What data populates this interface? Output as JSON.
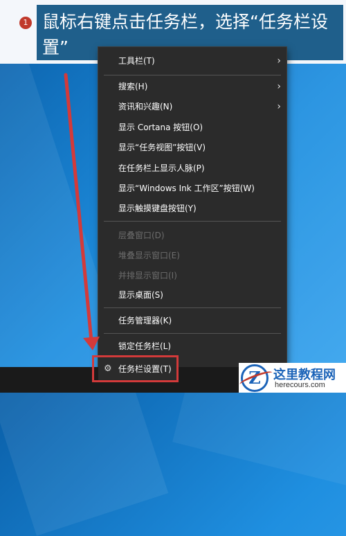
{
  "caption": {
    "step_number": "1",
    "text": "鼠标右键点击任务栏，选择“任务栏设置”"
  },
  "context_menu": {
    "items": [
      {
        "label": "工具栏(T)",
        "submenu": true,
        "enabled": true
      },
      {
        "label": "搜索(H)",
        "submenu": true,
        "enabled": true
      },
      {
        "label": "资讯和兴趣(N)",
        "submenu": true,
        "enabled": true
      },
      {
        "label": "显示 Cortana 按钮(O)",
        "submenu": false,
        "enabled": true
      },
      {
        "label": "显示“任务视图”按钮(V)",
        "submenu": false,
        "enabled": true
      },
      {
        "label": "在任务栏上显示人脉(P)",
        "submenu": false,
        "enabled": true
      },
      {
        "label": "显示“Windows Ink 工作区”按钮(W)",
        "submenu": false,
        "enabled": true
      },
      {
        "label": "显示触摸键盘按钮(Y)",
        "submenu": false,
        "enabled": true
      },
      {
        "label": "层叠窗口(D)",
        "submenu": false,
        "enabled": false
      },
      {
        "label": "堆叠显示窗口(E)",
        "submenu": false,
        "enabled": false
      },
      {
        "label": "并排显示窗口(I)",
        "submenu": false,
        "enabled": false
      },
      {
        "label": "显示桌面(S)",
        "submenu": false,
        "enabled": true
      },
      {
        "label": "任务管理器(K)",
        "submenu": false,
        "enabled": true
      },
      {
        "label": "锁定任务栏(L)",
        "submenu": false,
        "enabled": true
      },
      {
        "label": "任务栏设置(T)",
        "submenu": false,
        "enabled": true,
        "icon": "gear-icon",
        "highlighted": true
      }
    ]
  },
  "watermark": {
    "logo_letter": "Z",
    "name": "这里教程网",
    "url": "herecours.com"
  },
  "colors": {
    "menu_bg": "#2b2b2b",
    "caption_bg": "#1f5f8b",
    "highlight_border": "#d33a3a",
    "arrow": "#d33a3a"
  }
}
